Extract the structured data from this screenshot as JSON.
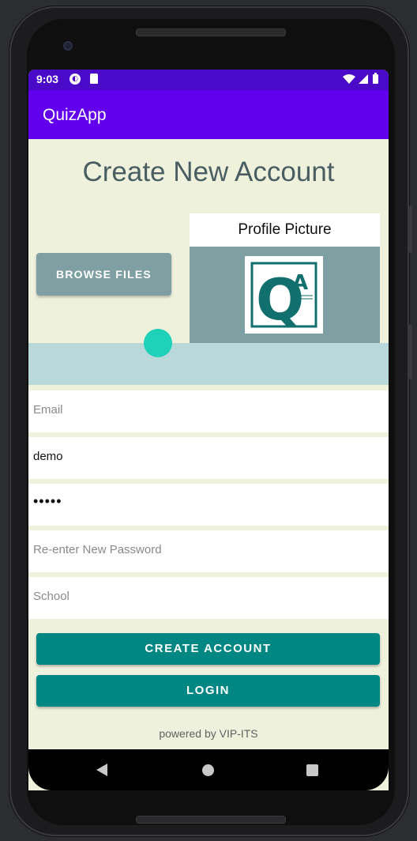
{
  "status_bar": {
    "time": "9:03",
    "notification_icons": [
      "cloud-icon",
      "sd-card-icon"
    ],
    "system_icons": [
      "wifi-icon",
      "signal-icon",
      "battery-icon"
    ]
  },
  "app_bar": {
    "title": "QuizApp"
  },
  "page": {
    "heading": "Create New Account"
  },
  "profile": {
    "browse_label": "BROWSE FILES",
    "picture_label": "Profile Picture",
    "logo_text_q": "Q",
    "logo_text_a": "A"
  },
  "form": {
    "email": {
      "placeholder": "Email",
      "value": ""
    },
    "username": {
      "placeholder": "",
      "value": "demo"
    },
    "password": {
      "placeholder": "",
      "value": "•••••"
    },
    "confirm_password": {
      "placeholder": "Re-enter New Password",
      "value": ""
    },
    "school": {
      "placeholder": "School",
      "value": ""
    }
  },
  "actions": {
    "create_account_label": "CREATE ACCOUNT",
    "login_label": "LOGIN"
  },
  "footer": {
    "powered_by": "powered by VIP-ITS"
  },
  "colors": {
    "status_bar": "#4a0ac8",
    "app_bar": "#6200ee",
    "background": "#eef2dd",
    "primary_button": "#008784",
    "secondary_button": "#7f9fa3",
    "band": "#b9d8da",
    "accent_dot": "#1ed1b8"
  }
}
